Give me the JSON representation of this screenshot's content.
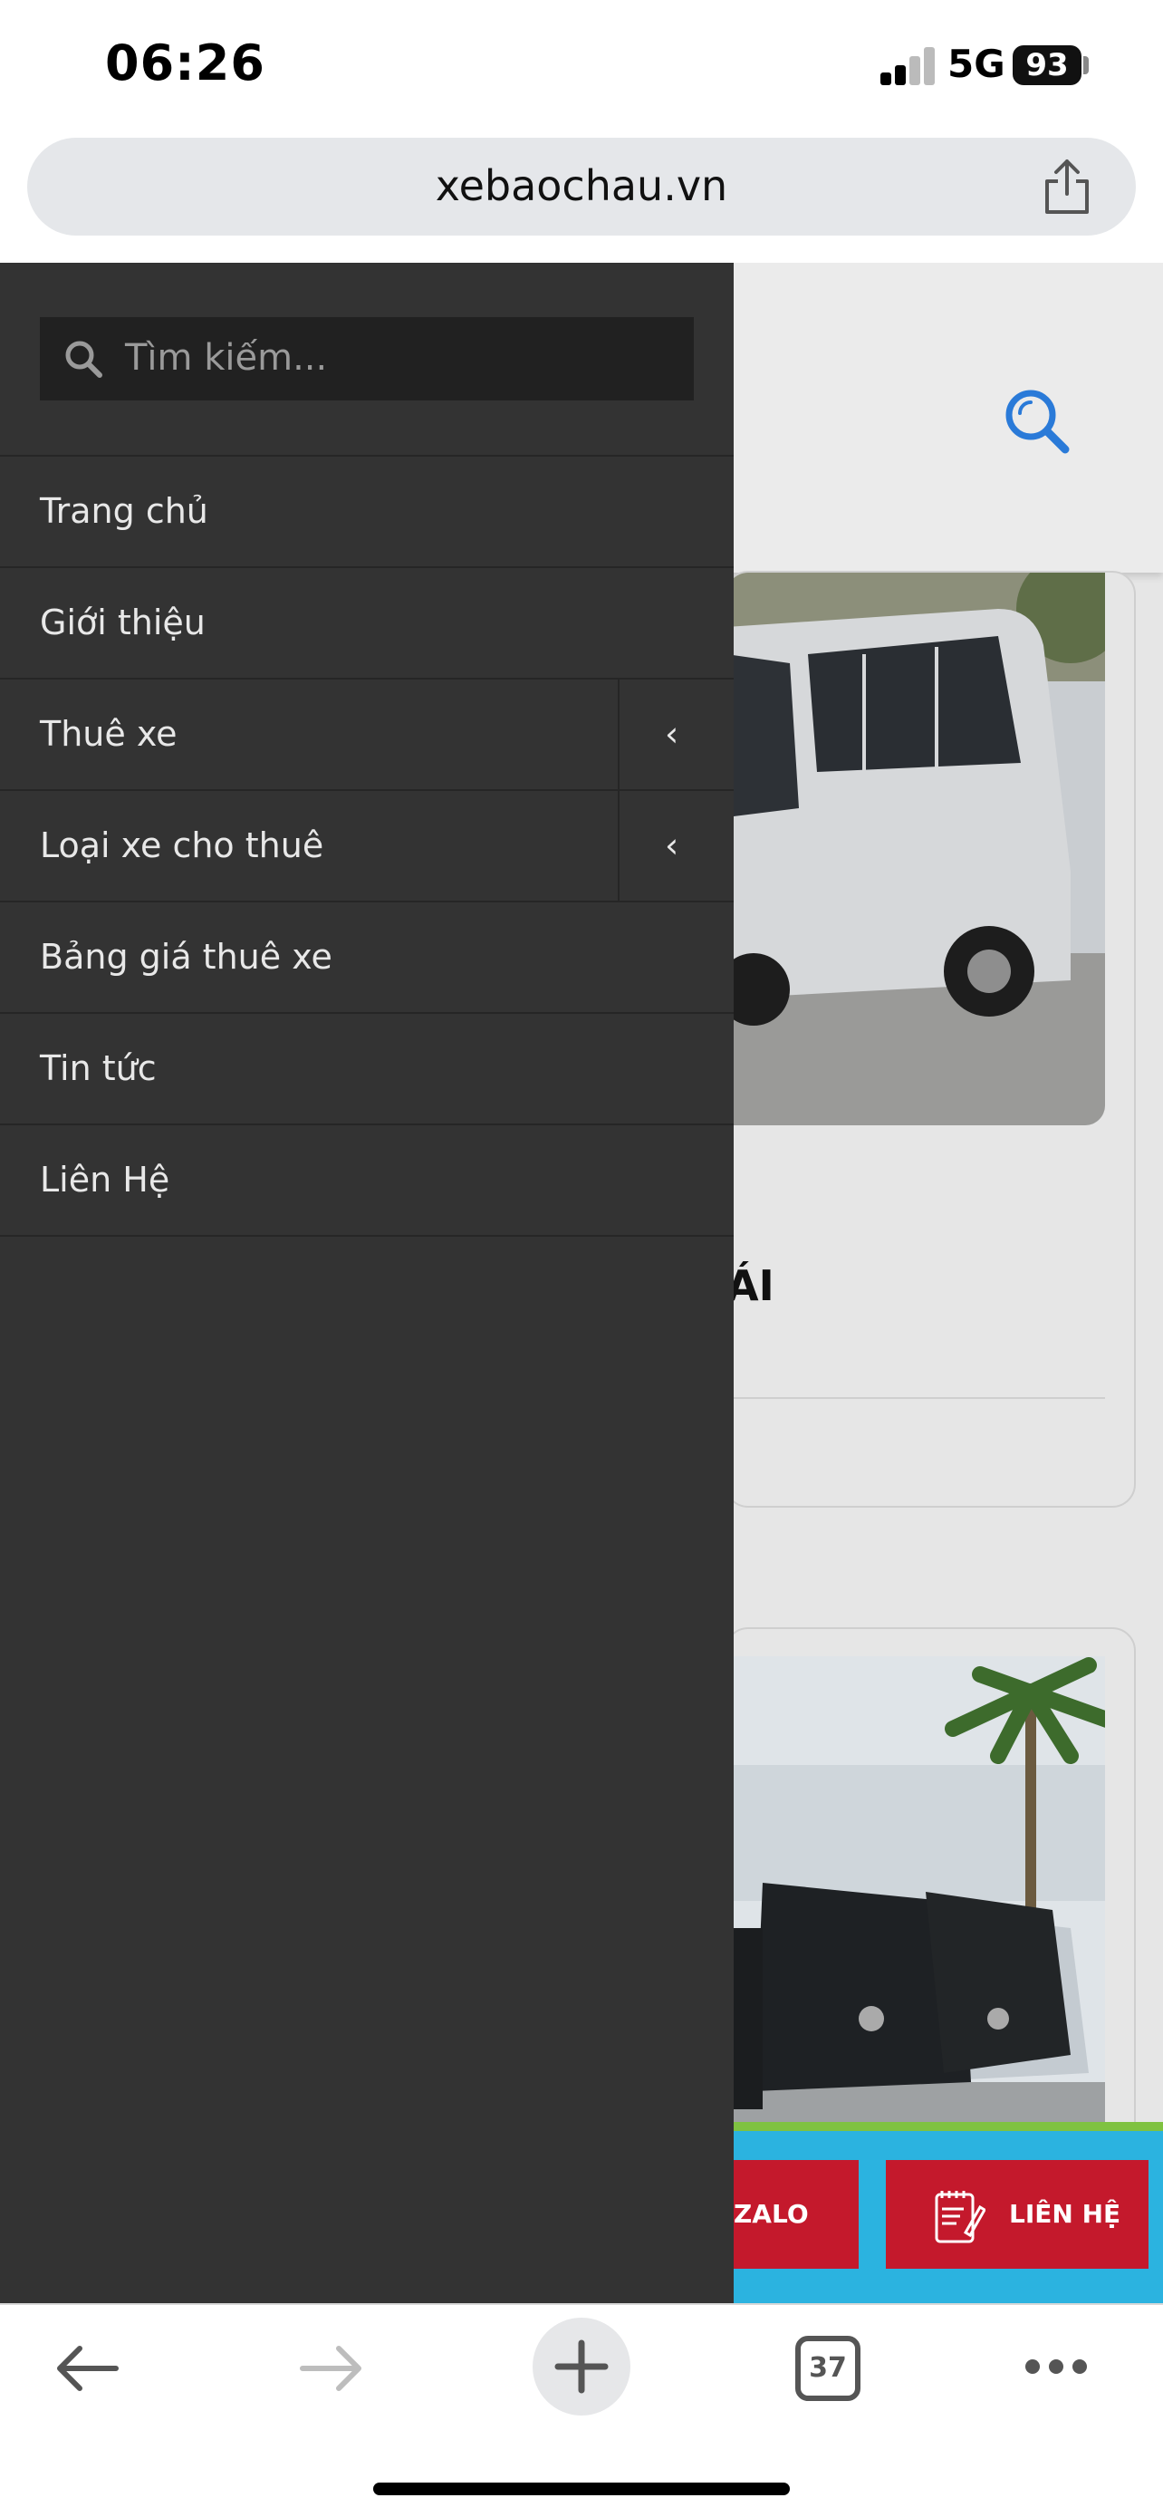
{
  "status": {
    "time": "06:26",
    "network": "5G",
    "battery": "93"
  },
  "browser": {
    "url": "xebaochau.vn",
    "tab_count": "37"
  },
  "drawer": {
    "search_placeholder": "Tìm kiếm...",
    "items": [
      {
        "label": "Trang chủ",
        "has_submenu": false
      },
      {
        "label": "Giới thiệu",
        "has_submenu": false
      },
      {
        "label": "Thuê xe",
        "has_submenu": true
      },
      {
        "label": "Loại xe cho thuê",
        "has_submenu": true
      },
      {
        "label": "Bảng giá thuê xe",
        "has_submenu": false
      },
      {
        "label": "Tin tức",
        "has_submenu": false
      },
      {
        "label": "Liên Hệ",
        "has_submenu": false
      }
    ],
    "submenu_glyph": "‹"
  },
  "page": {
    "card1_title_fragment": "ÁI",
    "zalo_label": "ZALO",
    "contact_label": "LIÊN HỆ"
  },
  "colors": {
    "accent_red": "#c4192c",
    "strip_blue": "#2bb3e0",
    "strip_green": "#7fc241",
    "drawer_bg": "#333333",
    "search_blue": "#2a7ad8"
  }
}
